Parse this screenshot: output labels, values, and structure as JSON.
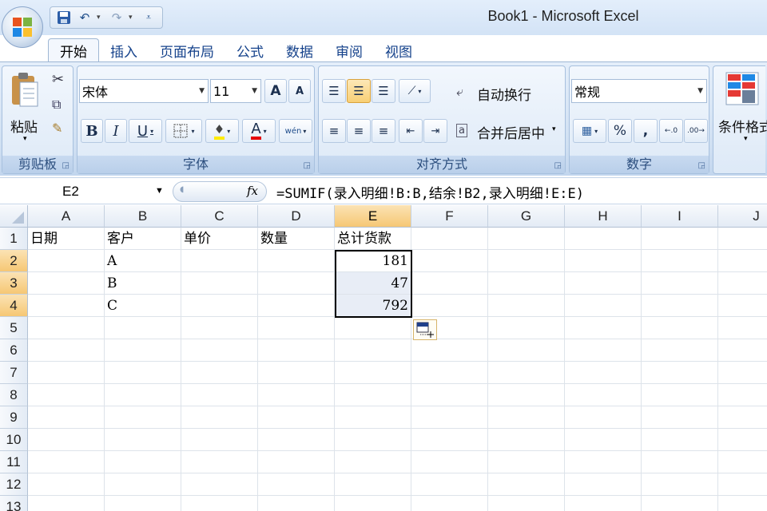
{
  "window": {
    "title": "Book1 - Microsoft Excel"
  },
  "quick_access": {
    "icons": [
      "save-icon",
      "undo-icon",
      "redo-icon",
      "customize-icon"
    ]
  },
  "tabs": [
    {
      "label": "开始",
      "active": true
    },
    {
      "label": "插入"
    },
    {
      "label": "页面布局"
    },
    {
      "label": "公式"
    },
    {
      "label": "数据"
    },
    {
      "label": "审阅"
    },
    {
      "label": "视图"
    }
  ],
  "ribbon": {
    "clipboard": {
      "paste_label": "粘贴",
      "group_label": "剪贴板"
    },
    "font": {
      "font_name": "宋体",
      "font_size": "11",
      "bold": "B",
      "italic": "I",
      "underline": "U",
      "font_color_glyph": "A",
      "phonetic_glyph": "wén",
      "group_label": "字体",
      "grow_glyph": "A",
      "shrink_glyph": "A"
    },
    "alignment": {
      "wrap_text": "自动换行",
      "merge_center": "合并后居中",
      "group_label": "对齐方式"
    },
    "number": {
      "format": "常规",
      "percent": "%",
      "comma": ",",
      "group_label": "数字"
    },
    "styles": {
      "conditional_format": "条件格式"
    }
  },
  "formula_bar": {
    "name_box": "E2",
    "fx_label": "fx",
    "formula": "=SUMIF(录入明细!B:B,结余!B2,录入明细!E:E)"
  },
  "sheet": {
    "columns": [
      "A",
      "B",
      "C",
      "D",
      "E",
      "F",
      "G",
      "H",
      "I",
      "J"
    ],
    "selected_column": "E",
    "rows": [
      "1",
      "2",
      "3",
      "4",
      "5",
      "6",
      "7",
      "8",
      "9",
      "10",
      "11",
      "12",
      "13"
    ],
    "cells": {
      "A1": "日期",
      "B1": "客户",
      "C1": "单价",
      "D1": "数量",
      "E1": "总计货款",
      "B2": "A",
      "E2": "181",
      "B3": "B",
      "E3": "47",
      "B4": "C",
      "E4": "792"
    }
  },
  "colors": {
    "accent": "#15428b",
    "selected_header": "#f6c774",
    "selection_fill": "#e8edf6"
  }
}
